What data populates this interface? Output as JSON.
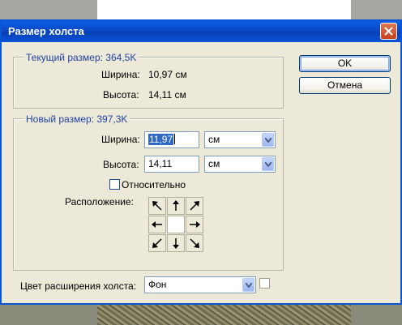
{
  "window": {
    "title": "Размер холста"
  },
  "current_size": {
    "legend": "Текущий размер: 364,5K",
    "width_label": "Ширина:",
    "width_value": "10,97 см",
    "height_label": "Высота:",
    "height_value": "14,11 см"
  },
  "new_size": {
    "legend": "Новый размер: 397,3K",
    "width_label": "Ширина:",
    "width_value": "11,97",
    "width_unit": "см",
    "height_label": "Высота:",
    "height_value": "14,11",
    "height_unit": "см",
    "relative_label": "Относительно",
    "relative_checked": false,
    "anchor_label": "Расположение:",
    "anchor_selected": "center"
  },
  "buttons": {
    "ok": "OK",
    "cancel": "Отмена"
  },
  "extension": {
    "label": "Цвет расширения холста:",
    "value": "Фон",
    "swatch_color": "#ffffff"
  },
  "icons": {
    "close": "close-icon",
    "dropdown": "chevron-down-icon",
    "anchors": [
      "arrow-up-left-icon",
      "arrow-up-icon",
      "arrow-up-right-icon",
      "arrow-left-icon",
      "center",
      "arrow-right-icon",
      "arrow-down-left-icon",
      "arrow-down-icon",
      "arrow-down-right-icon"
    ]
  }
}
